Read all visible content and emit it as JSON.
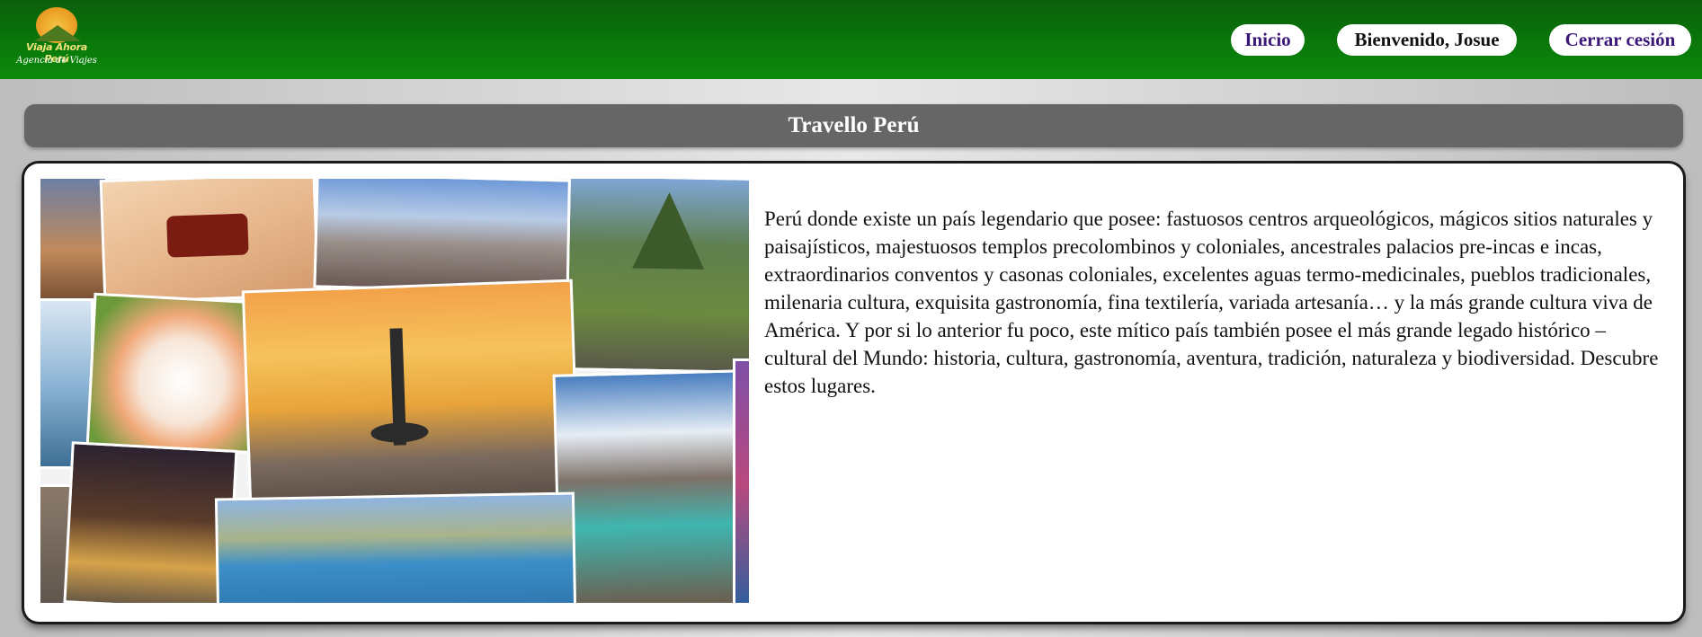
{
  "header": {
    "logo": {
      "brand_text": "Viaja Ahora Perú",
      "tagline": "Agencia de Viajes"
    },
    "nav": {
      "home_label": "Inicio",
      "welcome_text": "Bienvenido, Josue",
      "logout_label": "Cerrar cesión"
    }
  },
  "main": {
    "title": "Travello Perú",
    "description": "Perú donde existe un país legendario que posee: fastuosos centros arqueológicos, mágicos sitios naturales y paisajísticos, majestuosos templos precolombinos y coloniales, ancestrales palacios pre-incas e incas, extraordinarios conventos y casonas coloniales, excelentes aguas termo-medicinales, pueblos tradicionales, milenaria cultura, exquisita gastronomía, fina textilería, variada artesanía… y la más grande cultura viva de América. Y por si lo anterior fu poco, este mítico país también posee el más grande legado histórico – cultural del Mundo: historia, cultura, gastronomía, aventura, tradición, naturaleza y biodiversidad. Descubre estos lugares."
  },
  "colors": {
    "header_green": "#0a7a0a",
    "title_bar_gray": "#666666",
    "link_purple": "#3b177a"
  }
}
